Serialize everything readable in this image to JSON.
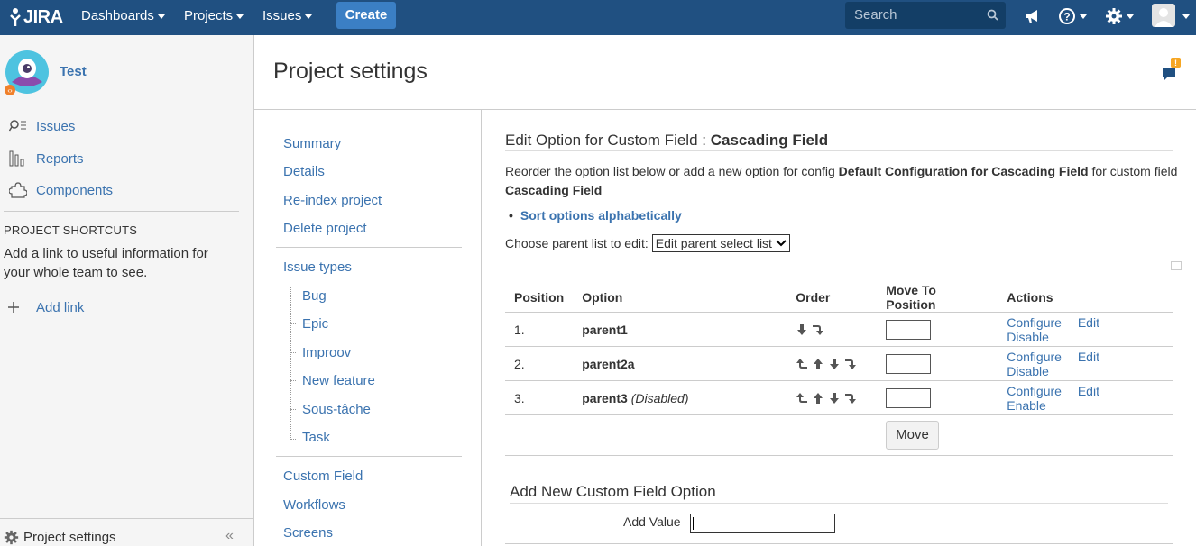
{
  "topbar": {
    "logo": "JIRA",
    "nav": [
      "Dashboards",
      "Projects",
      "Issues"
    ],
    "create_label": "Create",
    "search_placeholder": "Search"
  },
  "sidebar": {
    "project_name": "Test",
    "links": [
      "Issues",
      "Reports",
      "Components"
    ],
    "shortcuts_title": "PROJECT SHORTCUTS",
    "shortcuts_text": "Add a link to useful information for your whole team to see.",
    "add_link": "Add link",
    "footer_label": "Project settings",
    "collapse": "«"
  },
  "header": {
    "title": "Project settings",
    "feedback_badge": "!"
  },
  "settings_nav": {
    "summary": "Summary",
    "details": "Details",
    "reindex": "Re-index project",
    "delete": "Delete project",
    "issue_types": "Issue types",
    "issue_type_items": [
      "Bug",
      "Epic",
      "Improov",
      "New feature",
      "Sous-tâche",
      "Task"
    ],
    "custom_field": "Custom Field",
    "workflows": "Workflows",
    "screens": "Screens"
  },
  "edit": {
    "title_prefix": "Edit Option for Custom Field :",
    "title_field": "Cascading Field",
    "desc_part1": "Reorder the option list below or add a new option for config",
    "desc_config": "Default Configuration for Cascading Field",
    "desc_part2": "for custom field",
    "desc_field": "Cascading Field",
    "sort_link": "Sort options alphabetically",
    "parent_label": "Choose parent list to edit:",
    "parent_select": "Edit parent select list"
  },
  "table": {
    "headers": [
      "Position",
      "Option",
      "Order",
      "Move To Position",
      "Actions"
    ],
    "rows": [
      {
        "position": "1.",
        "option": "parent1",
        "note": "",
        "actions": [
          "Configure",
          "Edit",
          "Disable"
        ]
      },
      {
        "position": "2.",
        "option": "parent2a",
        "note": "",
        "actions": [
          "Configure",
          "Edit",
          "Disable"
        ]
      },
      {
        "position": "3.",
        "option": "parent3",
        "note": "(Disabled)",
        "actions": [
          "Configure",
          "Edit",
          "Enable"
        ]
      }
    ],
    "move_label": "Move"
  },
  "add_new": {
    "title": "Add New Custom Field Option",
    "value_label": "Add Value"
  },
  "colors": {
    "topbar": "#205081",
    "link": "#3b73af",
    "create": "#3b7fc4"
  }
}
